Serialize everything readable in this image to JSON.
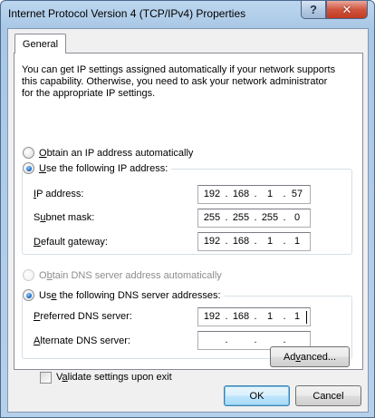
{
  "window": {
    "title": "Internet Protocol Version 4 (TCP/IPv4) Properties",
    "help_label": "?",
    "close_label": "✕"
  },
  "tabs": [
    {
      "label": "General",
      "selected": true
    }
  ],
  "intro_lines": [
    "You can get IP settings assigned automatically if your network supports",
    "this capability. Otherwise, you need to ask your network administrator",
    "for the appropriate IP settings."
  ],
  "ip_mode": {
    "auto": {
      "prefix": "",
      "mnemonic": "O",
      "rest": "btain an IP address automatically",
      "checked": false
    },
    "manual": {
      "prefix": "",
      "mnemonic": "U",
      "rest": "se the following IP address:",
      "checked": true
    }
  },
  "ip_fields": {
    "ip_address": {
      "prefix": "",
      "mnemonic": "I",
      "rest": "P address:",
      "octets": [
        "192",
        "168",
        "1",
        "57"
      ]
    },
    "subnet_mask": {
      "prefix": "S",
      "mnemonic": "u",
      "rest": "bnet mask:",
      "octets": [
        "255",
        "255",
        "255",
        "0"
      ]
    },
    "default_gateway": {
      "prefix": "",
      "mnemonic": "D",
      "rest": "efault gateway:",
      "octets": [
        "192",
        "168",
        "1",
        "1"
      ]
    }
  },
  "dns_mode": {
    "auto": {
      "prefix": "O",
      "mnemonic": "b",
      "rest": "tain DNS server address automatically",
      "checked": false,
      "disabled": true
    },
    "manual": {
      "prefix": "Us",
      "mnemonic": "e",
      "rest": " the following DNS server addresses:",
      "checked": true
    }
  },
  "dns_fields": {
    "preferred": {
      "prefix": "",
      "mnemonic": "P",
      "rest": "referred DNS server:",
      "octets": [
        "192",
        "168",
        "1",
        "1"
      ]
    },
    "alternate": {
      "prefix": "",
      "mnemonic": "A",
      "rest": "lternate DNS server:",
      "octets": [
        "",
        "",
        "",
        ""
      ]
    }
  },
  "validate": {
    "prefix": "V",
    "mnemonic": "a",
    "rest": "lidate settings upon exit",
    "checked": false
  },
  "buttons": {
    "advanced": {
      "prefix": "Ad",
      "mnemonic": "v",
      "rest": "anced..."
    },
    "ok": "OK",
    "cancel": "Cancel"
  },
  "ip_separator": "."
}
